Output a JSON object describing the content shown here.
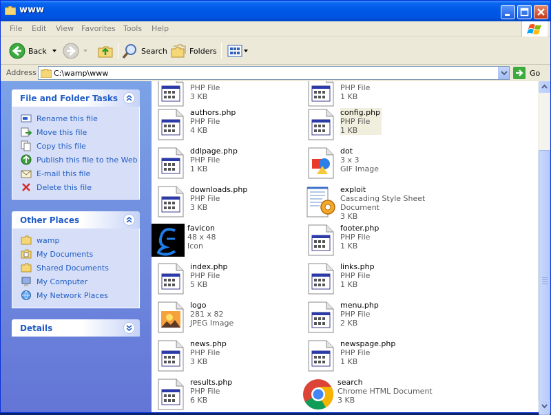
{
  "window": {
    "title": "www"
  },
  "menu": [
    "File",
    "Edit",
    "View",
    "Favorites",
    "Tools",
    "Help"
  ],
  "toolbar": {
    "back": "Back",
    "search": "Search",
    "folders": "Folders"
  },
  "address": {
    "label": "Address",
    "path": "C:\\wamp\\www",
    "go": "Go"
  },
  "tasks": {
    "title": "File and Folder Tasks",
    "items": [
      {
        "label": "Rename this file",
        "icon": "rename-icon"
      },
      {
        "label": "Move this file",
        "icon": "move-icon"
      },
      {
        "label": "Copy this file",
        "icon": "copy-icon"
      },
      {
        "label": "Publish this file to the Web",
        "icon": "publish-web-icon"
      },
      {
        "label": "E-mail this file",
        "icon": "email-icon"
      },
      {
        "label": "Delete this file",
        "icon": "delete-icon"
      }
    ]
  },
  "places": {
    "title": "Other Places",
    "items": [
      {
        "label": "wamp",
        "icon": "folder-icon"
      },
      {
        "label": "My Documents",
        "icon": "my-documents-icon"
      },
      {
        "label": "Shared Documents",
        "icon": "shared-folder-icon"
      },
      {
        "label": "My Computer",
        "icon": "computer-icon"
      },
      {
        "label": "My Network Places",
        "icon": "network-icon"
      }
    ]
  },
  "details": {
    "title": "Details"
  },
  "files": [
    {
      "name": "",
      "line2": "PHP File",
      "line3": "3 KB",
      "icon": "php-file-icon"
    },
    {
      "name": "",
      "line2": "PHP File",
      "line3": "1 KB",
      "icon": "php-file-icon"
    },
    {
      "name": "authors.php",
      "line2": "PHP File",
      "line3": "4 KB",
      "icon": "php-file-icon"
    },
    {
      "name": "config.php",
      "line2": "PHP File",
      "line3": "1 KB",
      "icon": "php-file-icon",
      "selected": true
    },
    {
      "name": "ddlpage.php",
      "line2": "PHP File",
      "line3": "1 KB",
      "icon": "php-file-icon"
    },
    {
      "name": "dot",
      "line2": "3 x 3",
      "line3": "GIF Image",
      "icon": "gif-image-icon"
    },
    {
      "name": "downloads.php",
      "line2": "PHP File",
      "line3": "3 KB",
      "icon": "php-file-icon"
    },
    {
      "name": "exploit",
      "line2": "Cascading Style Sheet Document",
      "line3": "3 KB",
      "icon": "css-document-icon"
    },
    {
      "name": "favicon",
      "line2": "48 x 48",
      "line3": "Icon",
      "icon": "favicon-thumbnail-icon"
    },
    {
      "name": "footer.php",
      "line2": "PHP File",
      "line3": "1 KB",
      "icon": "php-file-icon"
    },
    {
      "name": "index.php",
      "line2": "PHP File",
      "line3": "5 KB",
      "icon": "php-file-icon"
    },
    {
      "name": "links.php",
      "line2": "PHP File",
      "line3": "1 KB",
      "icon": "php-file-icon"
    },
    {
      "name": "logo",
      "line2": "281 x 82",
      "line3": "JPEG Image",
      "icon": "jpeg-image-icon"
    },
    {
      "name": "menu.php",
      "line2": "PHP File",
      "line3": "2 KB",
      "icon": "php-file-icon"
    },
    {
      "name": "news.php",
      "line2": "PHP File",
      "line3": "3 KB",
      "icon": "php-file-icon"
    },
    {
      "name": "newspage.php",
      "line2": "PHP File",
      "line3": "1 KB",
      "icon": "php-file-icon"
    },
    {
      "name": "results.php",
      "line2": "PHP File",
      "line3": "6 KB",
      "icon": "php-file-icon"
    },
    {
      "name": "search",
      "line2": "Chrome HTML Document",
      "line3": "3 KB",
      "icon": "chrome-document-icon"
    }
  ],
  "colors": {
    "titlebar": "#0054e3",
    "taskpane": "#6d8ee0",
    "link": "#215dc6"
  }
}
